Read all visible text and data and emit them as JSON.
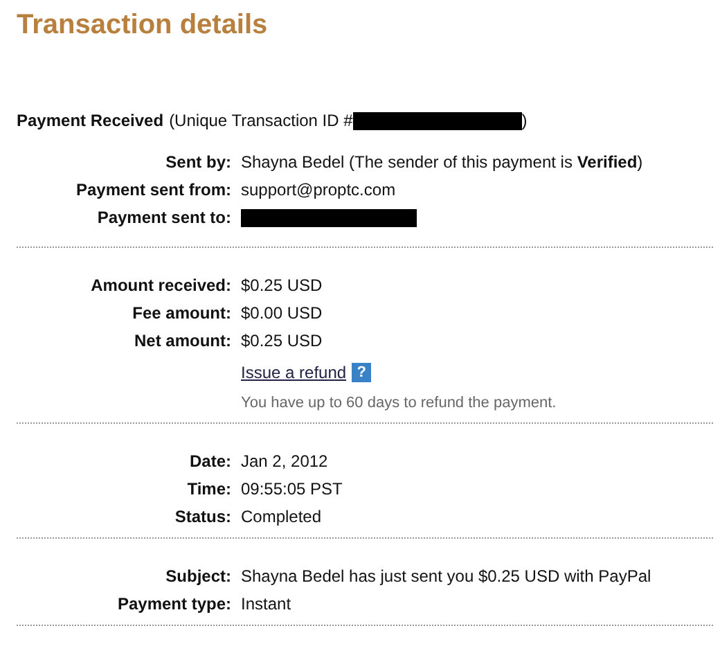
{
  "title": "Transaction details",
  "header": {
    "label": "Payment Received",
    "id_prefix": "(Unique Transaction ID #",
    "id_redacted": true,
    "id_suffix": ")"
  },
  "sections": [
    {
      "rows": [
        {
          "kind": "text",
          "label": "Sent by:",
          "value": "Shayna Bedel (The sender of this payment is **Verified**)"
        },
        {
          "kind": "text",
          "label": "Payment sent from:",
          "value": "support@proptc.com"
        },
        {
          "kind": "redacted",
          "label": "Payment sent to:"
        }
      ]
    },
    {
      "rows": [
        {
          "kind": "text",
          "label": "Amount received:",
          "value": "$0.25 USD"
        },
        {
          "kind": "text",
          "label": "Fee amount:",
          "value": "$0.00 USD"
        },
        {
          "kind": "text",
          "label": "Net amount:",
          "value": "$0.25 USD"
        }
      ],
      "refund": {
        "link": "Issue a refund",
        "help": "?",
        "note": "You have up to 60 days to refund the payment."
      }
    },
    {
      "rows": [
        {
          "kind": "text",
          "label": "Date:",
          "value": "Jan 2, 2012"
        },
        {
          "kind": "text",
          "label": "Time:",
          "value": "09:55:05 PST"
        },
        {
          "kind": "text",
          "label": "Status:",
          "value": "Completed"
        }
      ]
    },
    {
      "rows": [
        {
          "kind": "text",
          "label": "Subject:",
          "value": "Shayna Bedel has just sent you $0.25 USD with PayPal"
        },
        {
          "kind": "text",
          "label": "Payment type:",
          "value": "Instant"
        }
      ]
    }
  ]
}
